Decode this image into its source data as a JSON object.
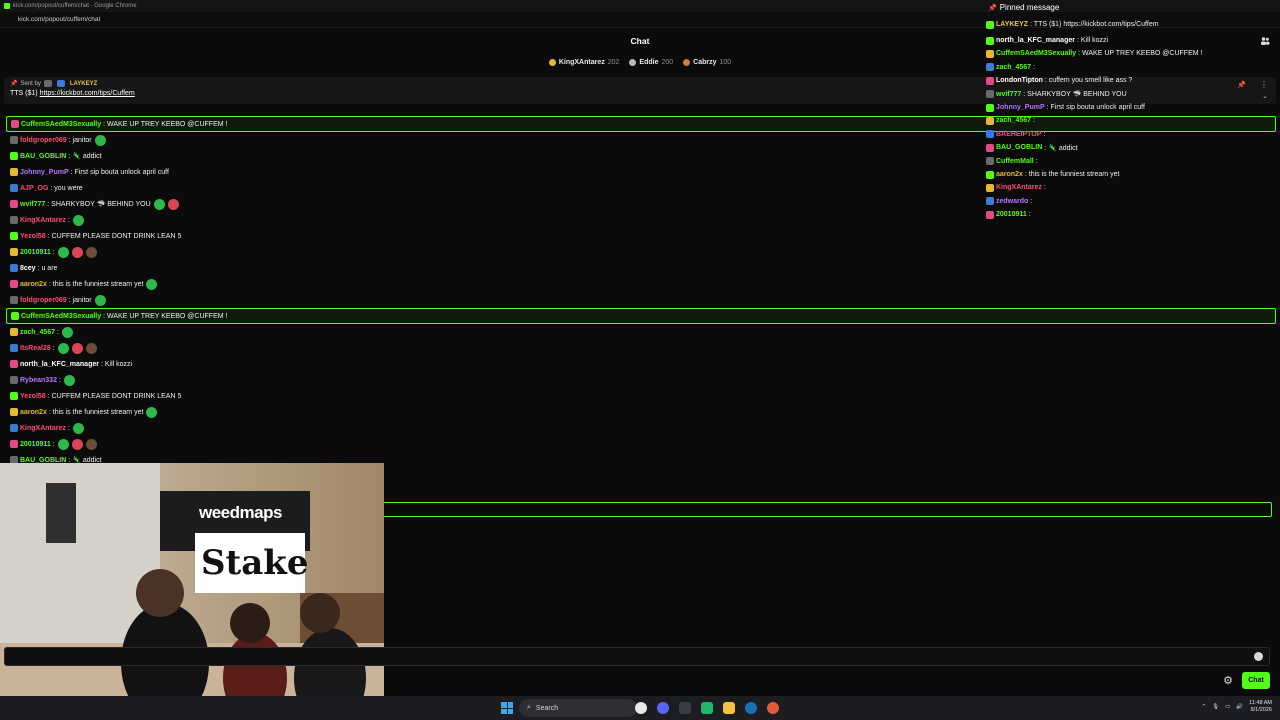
{
  "browser": {
    "title": "kick.com/popout/cuffem/chat - Google Chrome",
    "url": "kick.com/popout/cuffem/chat"
  },
  "chat": {
    "title": "Chat",
    "send_label": "Chat",
    "leaderboard": [
      {
        "name": "KingXAntarez",
        "count": "202",
        "color": "#e8b634"
      },
      {
        "name": "Eddie",
        "count": "200",
        "color": "#b8b8b8"
      },
      {
        "name": "Cabrzy",
        "count": "100",
        "color": "#d27b3a"
      }
    ],
    "pinned": {
      "sent_by_label": "Sent by",
      "sender": "LAYKEYZ",
      "message_prefix": "TTS ($1)",
      "link": "https://kickbot.com/tips/Cuffem"
    }
  },
  "messages": [
    {
      "user": "CuffemSAedM3Sexually",
      "color": "#53fc18",
      "text": ": WAKE UP TREY KEEBO @CUFFEM !",
      "highlight": true,
      "emotes": 0
    },
    {
      "user": "foldgroper069",
      "color": "#ff4b6e",
      "text": ": janitor",
      "highlight": false,
      "emotes": 1
    },
    {
      "user": "BAU_GOBLIN",
      "color": "#53fc18",
      "text": ": 🦎 addict",
      "highlight": false,
      "emotes": 0
    },
    {
      "user": "Johnny_PumP",
      "color": "#b675ff",
      "text": ": First sip bouta unlock april cuff",
      "highlight": false,
      "emotes": 0
    },
    {
      "user": "AJP_OG",
      "color": "#ff4b6e",
      "text": ": you were",
      "highlight": false,
      "emotes": 0
    },
    {
      "user": "wvif777",
      "color": "#53fc18",
      "text": ": SHARKYBOY 🦈 BEHIND YOU",
      "highlight": false,
      "emotes": 2
    },
    {
      "user": "KingXAntarez",
      "color": "#ff4b6e",
      "text": ":",
      "highlight": false,
      "emotes": 1
    },
    {
      "user": "Yezol58",
      "color": "#ff4b6e",
      "text": ": CUFFEM PLEASE DONT DRINK LEAN 5",
      "highlight": false,
      "emotes": 0
    },
    {
      "user": "20010911",
      "color": "#53fc18",
      "text": ":",
      "highlight": false,
      "emotes": 3
    },
    {
      "user": "8cey",
      "color": "#ffffff",
      "text": ": u are",
      "highlight": false,
      "emotes": 0
    },
    {
      "user": "aaron2x",
      "color": "#e8b634",
      "text": ": this is the funniest stream yet",
      "highlight": false,
      "emotes": 1
    },
    {
      "user": "foldgroper069",
      "color": "#ff4b6e",
      "text": ": janitor",
      "highlight": false,
      "emotes": 1
    },
    {
      "user": "CuffemSAedM3Sexually",
      "color": "#53fc18",
      "text": ": WAKE UP TREY KEEBO @CUFFEM !",
      "highlight": true,
      "emotes": 0
    },
    {
      "user": "zach_4567",
      "color": "#53fc18",
      "text": ":",
      "highlight": false,
      "emotes": 1
    },
    {
      "user": "ItsReal28",
      "color": "#ff4b6e",
      "text": ":",
      "highlight": false,
      "emotes": 3
    },
    {
      "user": "north_la_KFC_manager",
      "color": "#ffffff",
      "text": ": Kill kozzi",
      "highlight": false,
      "emotes": 0
    },
    {
      "user": "Rybean332",
      "color": "#b675ff",
      "text": ":",
      "highlight": false,
      "emotes": 1
    },
    {
      "user": "Yezol58",
      "color": "#ff4b6e",
      "text": ": CUFFEM PLEASE DONT DRINK LEAN 5",
      "highlight": false,
      "emotes": 0
    },
    {
      "user": "aaron2x",
      "color": "#e8b634",
      "text": ": this is the funniest stream yet",
      "highlight": false,
      "emotes": 1
    },
    {
      "user": "KingXAntarez",
      "color": "#ff4b6e",
      "text": ":",
      "highlight": false,
      "emotes": 1
    },
    {
      "user": "20010911",
      "color": "#53fc18",
      "text": ":",
      "highlight": false,
      "emotes": 3
    },
    {
      "user": "BAU_GOBLIN",
      "color": "#53fc18",
      "text": ": 🦎 addict",
      "highlight": false,
      "emotes": 0
    }
  ],
  "popout": {
    "pinned_label": "Pinned message",
    "pinned_line": {
      "user": "LAYKEYZ",
      "color": "#e6c35a",
      "text": ": TTS ($1) https://kickbot.com/tips/Cuffem"
    },
    "rows": [
      {
        "user": "north_la_KFC_manager",
        "color": "#ffffff",
        "text": ": Kill kozzi"
      },
      {
        "user": "CuffemSAedM3Sexually",
        "color": "#53fc18",
        "text": ": WAKE UP TREY KEEBO @CUFFEM !"
      },
      {
        "user": "zach_4567",
        "color": "#53fc18",
        "text": ":"
      },
      {
        "user": "LondonTipton",
        "color": "#ffffff",
        "text": ": cuffem you smell like ass ?"
      },
      {
        "user": "wvif777",
        "color": "#53fc18",
        "text": ": SHARKYBOY 🦈 BEHIND YOU"
      },
      {
        "user": "Johnny_PumP",
        "color": "#b675ff",
        "text": ": First sip bouta unlock april cuff"
      },
      {
        "user": "zach_4567",
        "color": "#53fc18",
        "text": ":"
      },
      {
        "user": "BAEHEIPTOP",
        "color": "#ff4b6e",
        "text": ":"
      },
      {
        "user": "BAU_GOBLIN",
        "color": "#53fc18",
        "text": ": 🦎 addict"
      },
      {
        "user": "CuffemMall",
        "color": "#53fc18",
        "text": ":"
      },
      {
        "user": "aaron2x",
        "color": "#e8b634",
        "text": ": this is the funniest stream yet"
      },
      {
        "user": "KingXAntarez",
        "color": "#ff4b6e",
        "text": ":"
      },
      {
        "user": "zedwardo",
        "color": "#b675ff",
        "text": ":"
      },
      {
        "user": "20010911",
        "color": "#53fc18",
        "text": ":"
      }
    ]
  },
  "video": {
    "banner_text": "weedmaps",
    "sign_text": "Stake"
  },
  "taskbar": {
    "search_placeholder": "Search",
    "time": "11:48 AM",
    "date": "8/1/2026"
  },
  "colors": {
    "accent": "#53fc18",
    "background": "#0b0b0c"
  }
}
